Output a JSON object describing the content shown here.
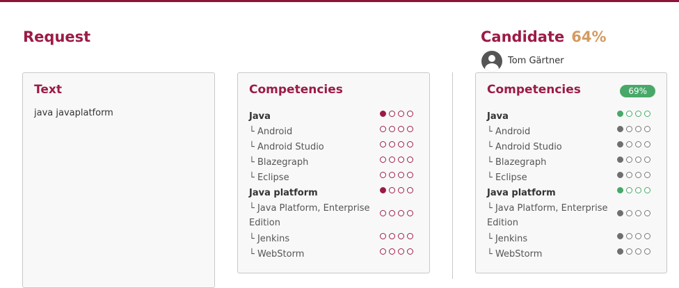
{
  "request": {
    "title": "Request",
    "text_card": {
      "title": "Text",
      "content": "java javaplatform"
    },
    "competencies_card": {
      "title": "Competencies",
      "items": [
        {
          "label": "Java",
          "level": 1,
          "main": true
        },
        {
          "label": "└ Android",
          "level": 0
        },
        {
          "label": "└ Android Studio",
          "level": 0
        },
        {
          "label": "└ Blazegraph",
          "level": 0
        },
        {
          "label": "└ Eclipse",
          "level": 0
        },
        {
          "label": "Java platform",
          "level": 1,
          "main": true
        },
        {
          "label": "└ Java Platform, Enterprise Edition",
          "level": 0
        },
        {
          "label": "└ Jenkins",
          "level": 0
        },
        {
          "label": "└ WebStorm",
          "level": 0
        }
      ]
    }
  },
  "candidate": {
    "title": "Candidate",
    "match_percent": "64%",
    "name": "Tom Gärtner",
    "competencies_card": {
      "title": "Competencies",
      "badge": "69%",
      "items": [
        {
          "label": "Java",
          "level": 1,
          "main": true
        },
        {
          "label": "└ Android",
          "level": 1
        },
        {
          "label": "└ Android Studio",
          "level": 1
        },
        {
          "label": "└ Blazegraph",
          "level": 1
        },
        {
          "label": "└ Eclipse",
          "level": 1
        },
        {
          "label": "Java platform",
          "level": 1,
          "main": true
        },
        {
          "label": "└ Java Platform, Enterprise Edition",
          "level": 1
        },
        {
          "label": "└ Jenkins",
          "level": 1
        },
        {
          "label": "└ WebStorm",
          "level": 1
        }
      ]
    }
  },
  "colors": {
    "brand": "#9b1b45",
    "accent_percent": "#d49a5f",
    "match_green": "#48a868"
  }
}
